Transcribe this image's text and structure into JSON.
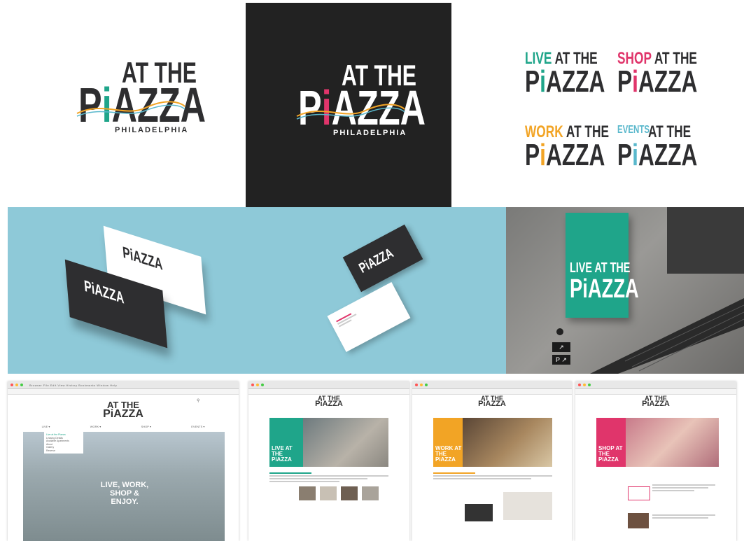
{
  "brand": {
    "at_the": "AT THE",
    "piazza_p": "P",
    "piazza_i": "i",
    "piazza_rest": "AZZA",
    "city": "PHILADELPHIA"
  },
  "variants": [
    {
      "prefix": "LIVE",
      "color": "#1fa58a"
    },
    {
      "prefix": "SHOP",
      "color": "#e0356b"
    },
    {
      "prefix": "WORK",
      "color": "#f2a425"
    },
    {
      "prefix": "EVENTS",
      "color": "#5ab8cc"
    }
  ],
  "colors": {
    "dark": "#2e2e30",
    "panel_black": "#222222",
    "sky": "#8ec9d8",
    "teal": "#1fa58a",
    "pink": "#e0356b",
    "orange": "#f2a425",
    "blue": "#5ab8cc"
  },
  "banner": {
    "prefix": "LIVE",
    "suffix": "AT THE",
    "main": "PiAZZA"
  },
  "sign": {
    "line1": "↗",
    "line2": "P ↗"
  },
  "site_home": {
    "nav": [
      "LIVE ▾",
      "WORK ▾",
      "SHOP ▾",
      "EVENTS ▾"
    ],
    "dropdown": [
      "Live at the Piazza",
      "Leasing Details",
      "Available Apartments",
      "About",
      "Gallery",
      "Reserve"
    ],
    "hero": "LIVE, WORK, SHOP & ENJOY."
  },
  "site_pages": [
    {
      "label": "LIVE AT THE PiAZZA",
      "color": "#1fa58a"
    },
    {
      "label": "WORK AT THE PiAZZA",
      "color": "#f2a425"
    },
    {
      "label": "SHOP AT THE PiAZZA",
      "color": "#e0356b"
    }
  ]
}
